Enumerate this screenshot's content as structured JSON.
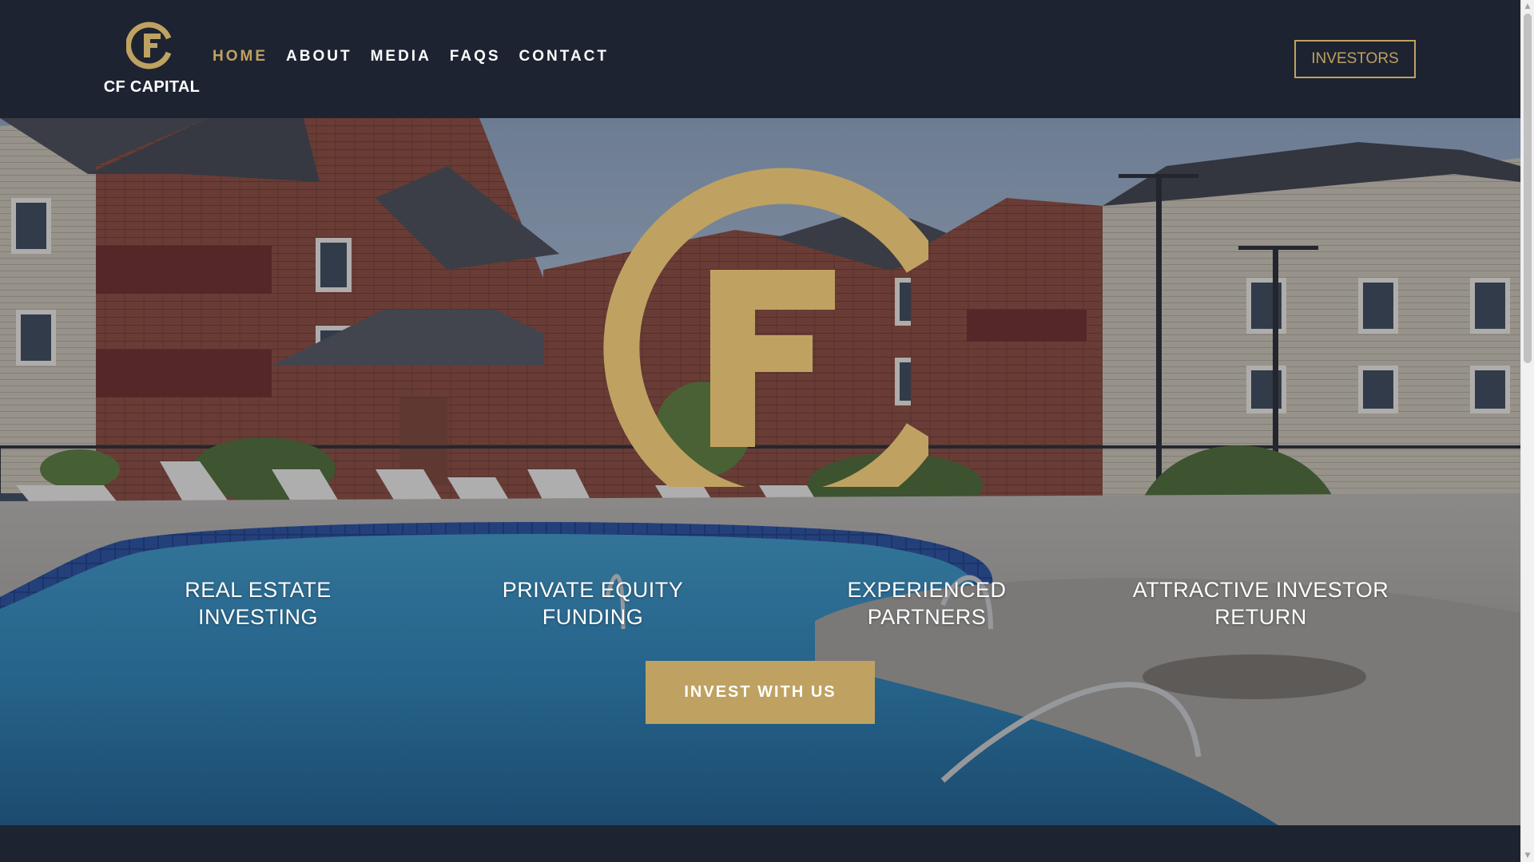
{
  "header": {
    "logo_text": "CF CAPITAL",
    "nav": [
      {
        "label": "HOME",
        "active": true
      },
      {
        "label": "ABOUT",
        "active": false
      },
      {
        "label": "MEDIA",
        "active": false
      },
      {
        "label": "FAQS",
        "active": false
      },
      {
        "label": "CONTACT",
        "active": false
      }
    ],
    "investors_label": "INVESTORS"
  },
  "hero": {
    "features": [
      {
        "line1": "REAL ESTATE",
        "line2": "INVESTING"
      },
      {
        "line1": "PRIVATE EQUITY",
        "line2": "FUNDING"
      },
      {
        "line1": "EXPERIENCED",
        "line2": "PARTNERS"
      },
      {
        "line1": "ATTRACTIVE INVESTOR",
        "line2": "RETURN"
      }
    ],
    "cta_label": "INVEST WITH US"
  },
  "colors": {
    "navy": "#1d2331",
    "gold": "#bfa261",
    "white": "#ffffff"
  },
  "icons": {
    "logo": "cf-monogram-icon",
    "scroll_up": "scroll-up-arrow-icon",
    "scroll_down": "scroll-down-arrow-icon"
  }
}
